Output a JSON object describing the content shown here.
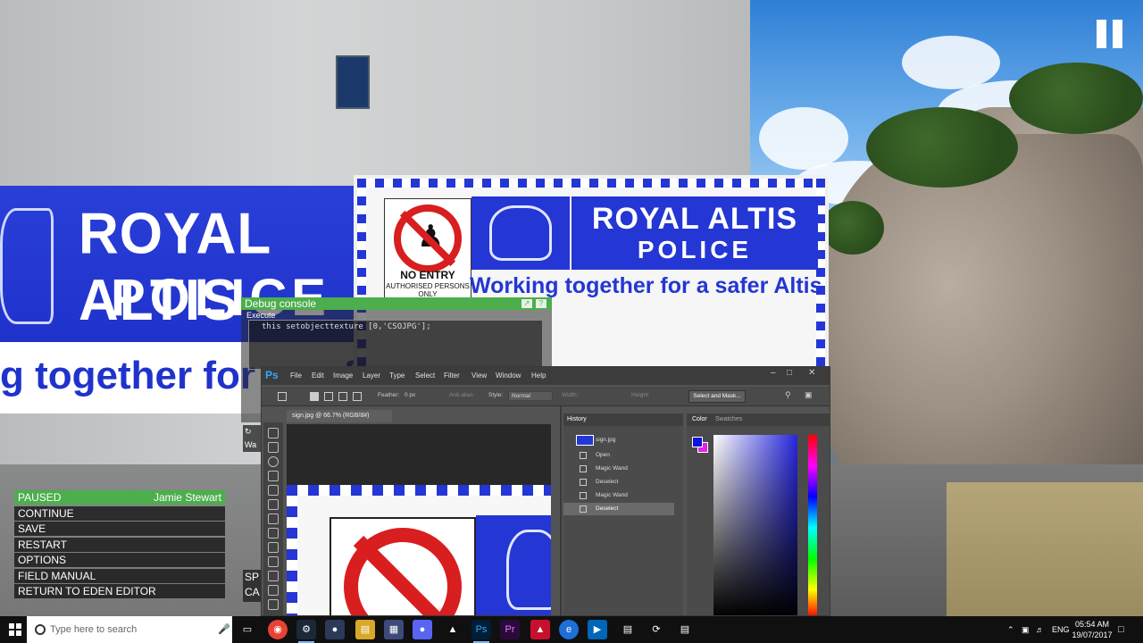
{
  "game": {
    "banner_left": {
      "line1": "ROYAL ALTIS",
      "line2": "POLICE",
      "line3": "g together for a safer Altis"
    },
    "sign": {
      "no_entry": "NO ENTRY",
      "authorised": "AUTHORISED PERSONS ONLY",
      "title1": "ROYAL ALTIS",
      "title2": "POLICE",
      "motto": "Working together for a safer Altis"
    }
  },
  "debug_console": {
    "title": "Debug console",
    "execute_label": "Execute",
    "code": "this setobjecttexture [0,'CSOJPG'];"
  },
  "pause_menu": {
    "header": "PAUSED",
    "player_name": "Jamie Stewart",
    "items": [
      "CONTINUE",
      "SAVE",
      "RESTART",
      "OPTIONS",
      "FIELD MANUAL",
      "RETURN TO EDEN EDITOR"
    ]
  },
  "side_fragments": {
    "bottom": [
      "SP",
      "CA"
    ],
    "top": "Wa"
  },
  "photoshop": {
    "logo": "Ps",
    "menu": [
      "File",
      "Edit",
      "Image",
      "Layer",
      "Type",
      "Select",
      "Filter",
      "View",
      "Window",
      "Help"
    ],
    "options": {
      "feather_label": "Feather:",
      "feather_value": "0 px",
      "anti_alias": "Anti-alias",
      "style_label": "Style:",
      "style_value": "Normal",
      "width_label": "Width:",
      "height_label": "Height:",
      "select_mask": "Select and Mask..."
    },
    "document_tab": "sign.jpg @ 66.7% (RGB/8#)",
    "history": {
      "title": "History",
      "snapshot": "sign.jpg",
      "steps": [
        "Open",
        "Magic Wand",
        "Deselect",
        "Magic Wand",
        "Deselect"
      ],
      "active_index": 4
    },
    "color": {
      "tab_color": "Color",
      "tab_swatches": "Swatches",
      "foreground": "#0d13d8",
      "background": "#e025e0"
    }
  },
  "taskbar": {
    "search_placeholder": "Type here to search",
    "language": "ENG",
    "time": "05:54 AM",
    "date": "19/07/2017"
  }
}
